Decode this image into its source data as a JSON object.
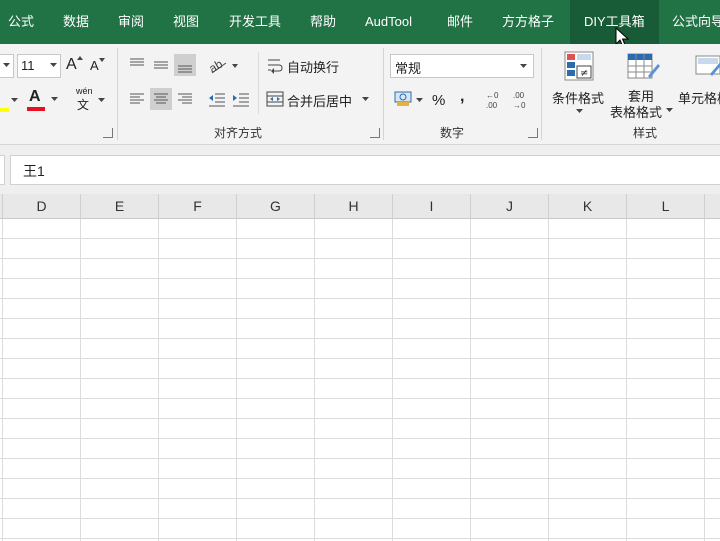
{
  "tabs": [
    {
      "label": "公式"
    },
    {
      "label": "数据"
    },
    {
      "label": "审阅"
    },
    {
      "label": "视图"
    },
    {
      "label": "开发工具"
    },
    {
      "label": "帮助"
    },
    {
      "label": "AudTool"
    },
    {
      "label": "邮件"
    },
    {
      "label": "方方格子"
    },
    {
      "label": "DIY工具箱"
    },
    {
      "label": "公式向导"
    }
  ],
  "font": {
    "size": "11",
    "grow": "A",
    "shrink": "A",
    "phonetic_top": "wén",
    "phonetic_bottom": "文",
    "font_color_glyph": "A"
  },
  "alignment": {
    "wrap_text": "自动换行",
    "merge_center": "合并后居中",
    "group_label": "对齐方式"
  },
  "number": {
    "format": "常规",
    "percent": "%",
    "comma": ",",
    "group_label": "数字"
  },
  "styles": {
    "conditional": "条件格式",
    "table_line1": "套用",
    "table_line2": "表格格式",
    "cell_styles": "单元格样式",
    "group_label": "样式"
  },
  "formula": {
    "content": "王1"
  },
  "columns": [
    "D",
    "E",
    "F",
    "G",
    "H",
    "I",
    "J",
    "K",
    "L"
  ],
  "colors": {
    "ribbon_tab_bg": "#217346",
    "active_tab_bg": "#185c37",
    "font_color_red": "#e81123",
    "fill_yellow": "#ffff00"
  }
}
